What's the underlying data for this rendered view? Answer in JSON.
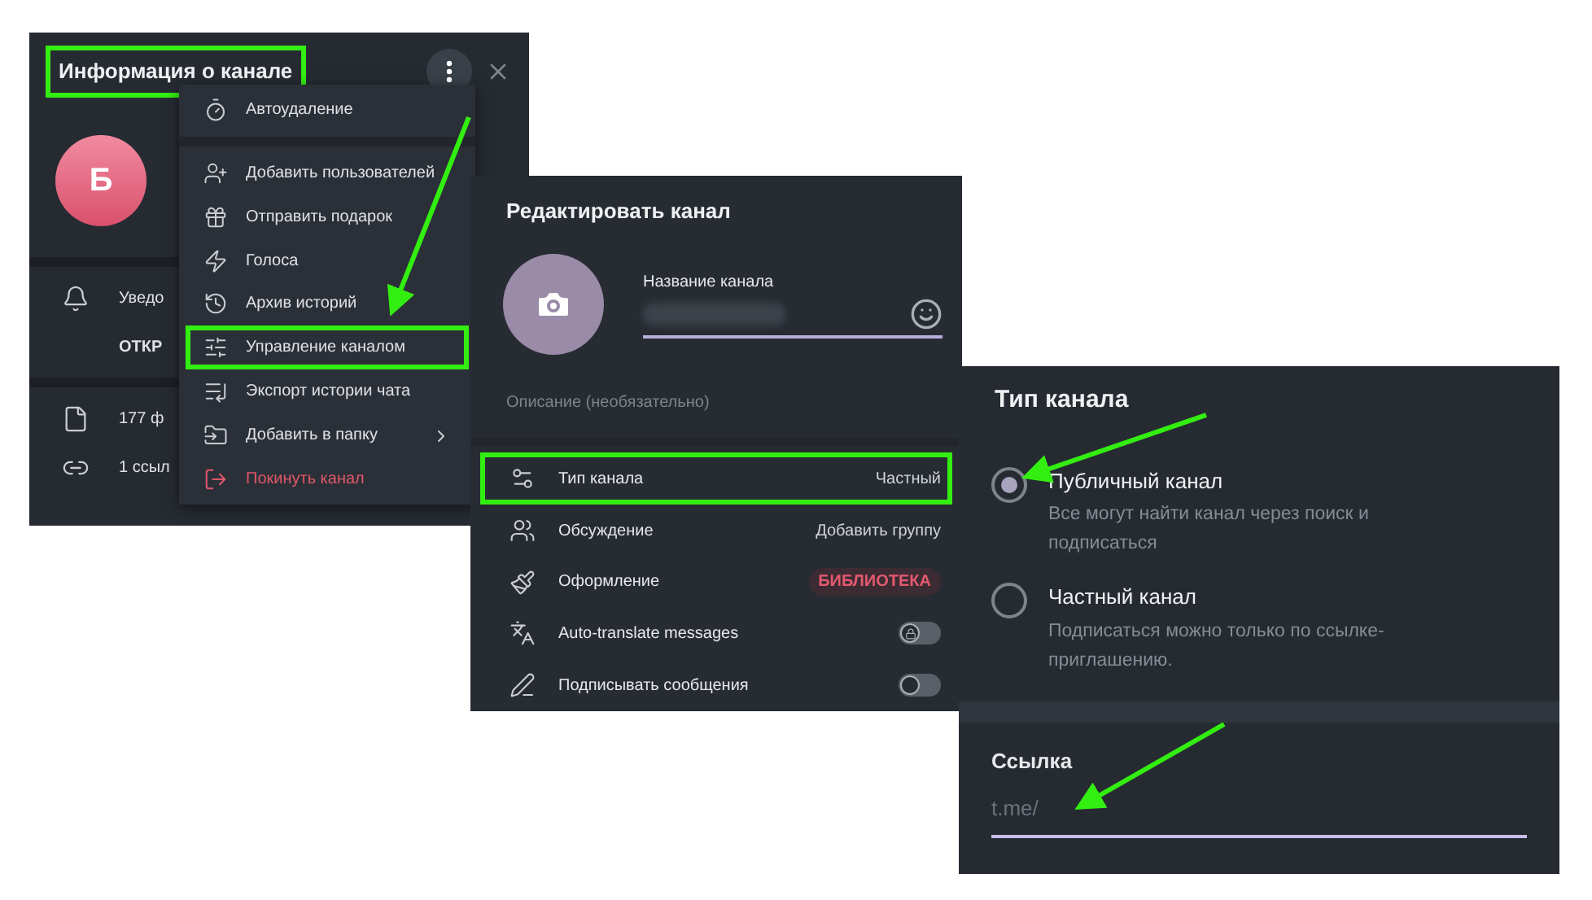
{
  "channel_info": {
    "title": "Информация о канале",
    "title_highlighted": true,
    "avatar_letter": "Б",
    "rows": [
      {
        "kind": "notifications",
        "text": "Уведо"
      },
      {
        "kind": "action",
        "text": "ОТКР"
      },
      {
        "kind": "files",
        "text": "177 ф"
      },
      {
        "kind": "links",
        "text": "1 ссыл"
      }
    ],
    "menu": [
      {
        "label": "Автоудаление",
        "kind": "normal",
        "highlighted": false,
        "submenu": false
      },
      {
        "label": "Добавить пользователей",
        "kind": "normal",
        "highlighted": false,
        "submenu": false
      },
      {
        "label": "Отправить подарок",
        "kind": "normal",
        "highlighted": false,
        "submenu": false
      },
      {
        "label": "Голоса",
        "kind": "normal",
        "highlighted": false,
        "submenu": false
      },
      {
        "label": "Архив историй",
        "kind": "normal",
        "highlighted": false,
        "submenu": false
      },
      {
        "label": "Управление каналом",
        "kind": "normal",
        "highlighted": true,
        "submenu": false
      },
      {
        "label": "Экспорт истории чата",
        "kind": "normal",
        "highlighted": false,
        "submenu": false
      },
      {
        "label": "Добавить в папку",
        "kind": "normal",
        "highlighted": false,
        "submenu": true
      },
      {
        "label": "Покинуть канал",
        "kind": "danger",
        "highlighted": false,
        "submenu": false
      }
    ]
  },
  "edit_channel": {
    "title": "Редактировать канал",
    "name_label": "Название канала",
    "description_placeholder": "Описание (необязательно)",
    "settings": [
      {
        "label": "Тип канала",
        "kind": "value",
        "value": "Частный",
        "highlighted": true
      },
      {
        "label": "Обсуждение",
        "kind": "value",
        "value": "Добавить группу",
        "highlighted": false
      },
      {
        "label": "Оформление",
        "kind": "badge",
        "value": "БИБЛИОТЕКА",
        "highlighted": false
      },
      {
        "label": "Auto-translate messages",
        "kind": "toggle",
        "on": false,
        "locked": true,
        "highlighted": false
      },
      {
        "label": "Подписывать сообщения",
        "kind": "toggle",
        "on": false,
        "locked": false,
        "highlighted": false
      }
    ]
  },
  "channel_type": {
    "title": "Тип канала",
    "options": [
      {
        "label": "Публичный канал",
        "description": "Все могут найти канал через поиск и подписаться",
        "selected": true
      },
      {
        "label": "Частный канал",
        "description": "Подписаться можно только по ссылке-приглашению.",
        "selected": false
      }
    ],
    "link_label": "Ссылка",
    "link_placeholder": "t.me/"
  }
}
